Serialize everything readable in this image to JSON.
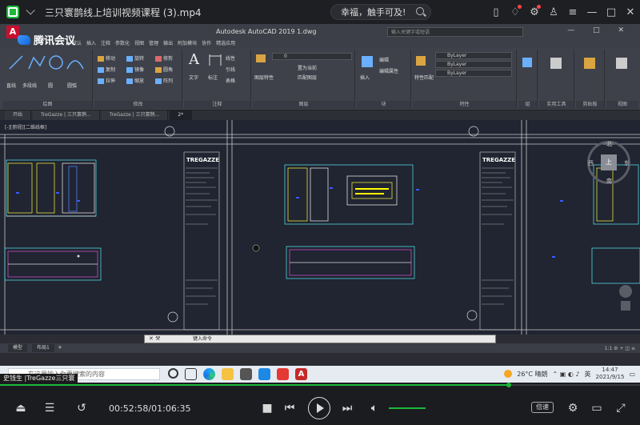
{
  "player": {
    "title": "三只寰鹊线上培训视频课程 (3).mp4",
    "promo_text": "幸福，触手可及!",
    "current_time": "00:52:58",
    "duration": "01:06:35",
    "time_separator": "/",
    "speed_label": "倍速",
    "progress_fraction": 0.795,
    "volume_fraction": 1.0,
    "accent_color": "#1bb93a",
    "top_icons": [
      "phone-icon",
      "bell-icon",
      "settings-icon",
      "tshirt-icon",
      "menu-icon",
      "minimize-icon",
      "maximize-icon",
      "close-icon"
    ]
  },
  "overlay": {
    "watermark": "腾讯会议",
    "caption": "史钱生 |TreGazze三只寰"
  },
  "autocad": {
    "window_title": "Autodesk AutoCAD 2019    1.dwg",
    "find_placeholder": "输入关键字或短语",
    "ribbon_tabs": [
      "默认",
      "插入",
      "注释",
      "参数化",
      "视图",
      "管理",
      "输出",
      "附加模块",
      "协作",
      "精选应用"
    ],
    "ribbon_groups": {
      "draw": {
        "label": "绘图",
        "tools": [
          "直线",
          "多段线",
          "圆",
          "圆弧"
        ]
      },
      "modify": {
        "label": "修改",
        "tools": [
          "移动",
          "旋转",
          "修剪",
          "复制",
          "镜像",
          "圆角",
          "拉伸",
          "缩放",
          "阵列"
        ]
      },
      "annotation": {
        "label": "注释",
        "tools": [
          "文字",
          "标注",
          "线性",
          "引线",
          "表格"
        ]
      },
      "layers": {
        "label": "图层",
        "tools": [
          "图层特性",
          "置为当前",
          "匹配图层"
        ],
        "layer_value": "0"
      },
      "block": {
        "label": "块",
        "tools": [
          "插入",
          "编辑",
          "编辑属性"
        ]
      },
      "properties": {
        "label": "特性",
        "tools": [
          "特性匹配"
        ],
        "values": [
          "ByLayer",
          "ByLayer",
          "ByLayer"
        ]
      },
      "groups": {
        "label": "组"
      },
      "utilities": {
        "label": "实用工具"
      },
      "clipboard": {
        "label": "剪贴板"
      },
      "view": {
        "label": "视图"
      }
    },
    "doc_tabs": [
      "开始",
      "TreGazze | 三只寰鹊...",
      "TreGazze | 三只寰鹊...",
      "2*"
    ],
    "viewport_label": "[-][俯视][二维线框]",
    "viewcube": {
      "north": "北",
      "south": "南",
      "west": "西",
      "east": "东",
      "top": "上"
    },
    "title_block_brand": "TREGAZZE",
    "command_placeholder": "键入命令",
    "layout_tabs": [
      "模型",
      "布局1"
    ],
    "status_scale": "1:1"
  },
  "taskbar": {
    "search_placeholder": "在这里输入你要搜索的内容",
    "weather": "26°C 晴朗",
    "ime": "英",
    "time": "14:47",
    "date": "2021/9/15"
  }
}
